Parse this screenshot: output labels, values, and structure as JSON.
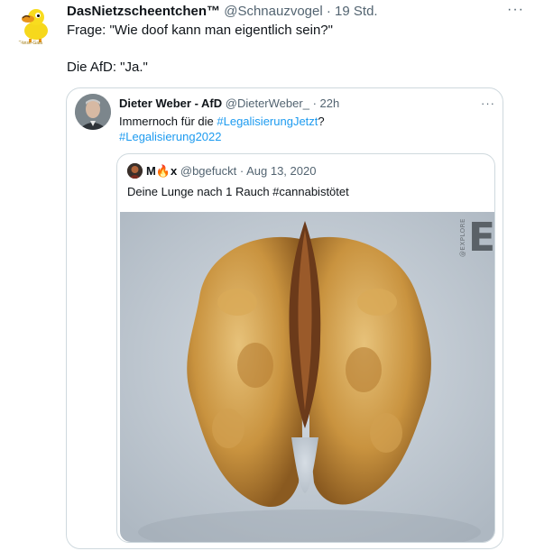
{
  "tweet": {
    "display_name": "DasNietzscheentchen™",
    "handle": "@Schnauzvogel",
    "separator": "·",
    "time": "19 Std.",
    "more": "···",
    "avatar_caption": "Gänse-Gala",
    "lines": [
      "Frage: \"Wie doof kann man eigentlich sein?\"",
      "Die AfD: \"Ja.\""
    ]
  },
  "quote": {
    "display_name": "Dieter Weber - AfD",
    "handle": "@DieterWeber_",
    "separator": "·",
    "time": "22h",
    "more": "···",
    "text_prefix": "Immernoch für die ",
    "hashtag1": "#LegalisierungJetzt",
    "text_suffix": "?",
    "hashtag2": "#Legalisierung2022"
  },
  "nested_quote": {
    "display_name": "M🔥x",
    "handle": "@bgefuckt",
    "separator": "·",
    "date": "Aug 13, 2020",
    "text": "Deine Lunge nach 1 Rauch #cannabistötet",
    "watermark_side": "@EXPLORE",
    "watermark_letter": "E"
  },
  "colors": {
    "hashtag": "#1d9bf0",
    "secondary_text": "#536471",
    "border": "#cfd9de"
  }
}
